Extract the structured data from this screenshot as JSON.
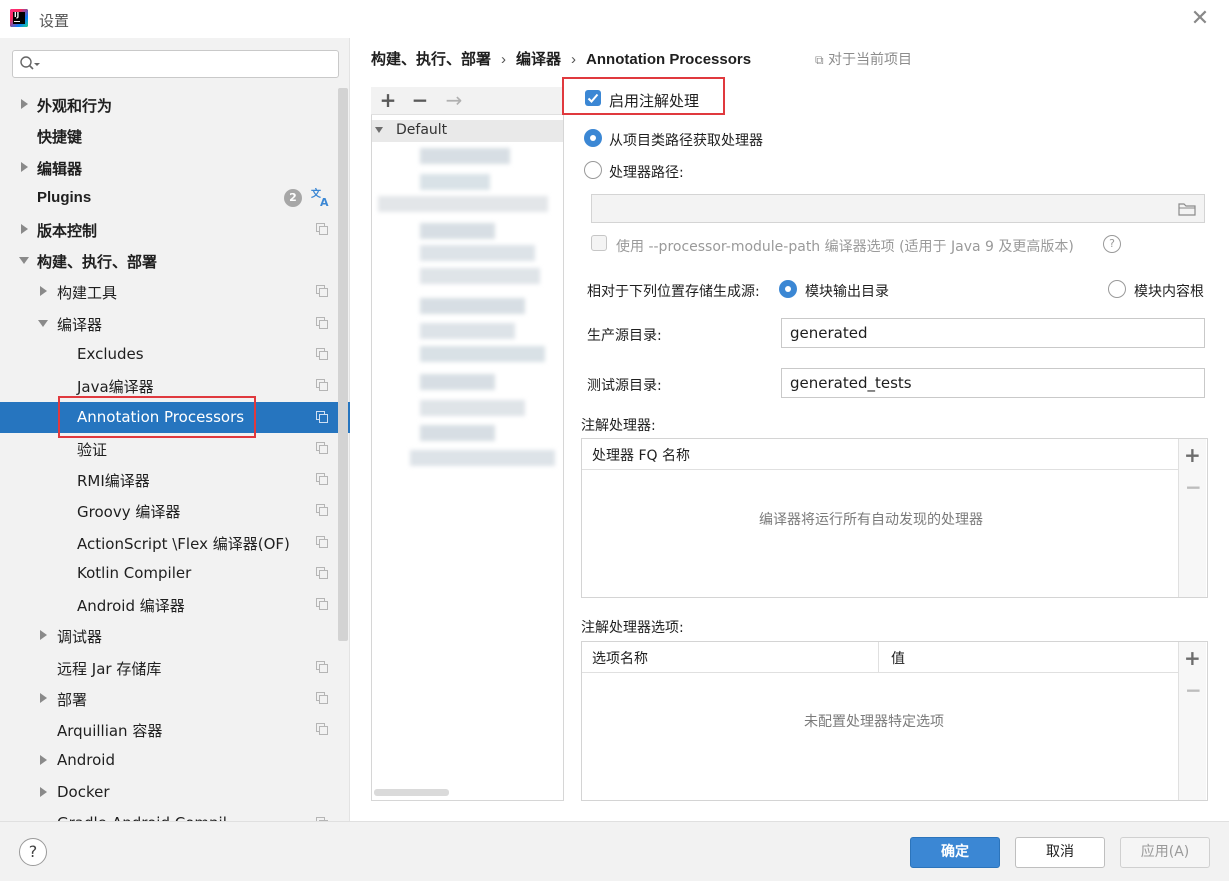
{
  "window": {
    "title": "设置"
  },
  "sidebar": {
    "search_placeholder": "",
    "plugins_badge": "2",
    "items": [
      {
        "label": "外观和行为",
        "arrow": "right",
        "bold": true
      },
      {
        "label": "快捷键",
        "bold": true
      },
      {
        "label": "编辑器",
        "arrow": "right",
        "bold": true
      },
      {
        "label": "Plugins",
        "bold": true
      },
      {
        "label": "版本控制",
        "arrow": "right",
        "bold": true
      },
      {
        "label": "构建、执行、部署",
        "arrow": "down",
        "bold": true
      },
      {
        "label": "构建工具",
        "arrow": "right"
      },
      {
        "label": "编译器",
        "arrow": "down"
      },
      {
        "label": "Excludes"
      },
      {
        "label": "Java编译器"
      },
      {
        "label": "Annotation Processors",
        "selected": true
      },
      {
        "label": "验证"
      },
      {
        "label": "RMI编译器"
      },
      {
        "label": "Groovy 编译器"
      },
      {
        "label": "ActionScript \\Flex 编译器(OF)"
      },
      {
        "label": "Kotlin Compiler"
      },
      {
        "label": "Android 编译器"
      },
      {
        "label": "调试器",
        "arrow": "right"
      },
      {
        "label": "远程 Jar 存储库"
      },
      {
        "label": "部署",
        "arrow": "right"
      },
      {
        "label": "Arquillian 容器"
      },
      {
        "label": "Android",
        "arrow": "right"
      },
      {
        "label": "Docker",
        "arrow": "right"
      },
      {
        "label": "Gradle-Android Compil..."
      }
    ]
  },
  "breadcrumb": {
    "part1": "构建、执行、部署",
    "part2": "编译器",
    "part3": "Annotation Processors",
    "scope": "对于当前项目"
  },
  "profiles": {
    "default_label": "Default"
  },
  "settings": {
    "enable_label": "启用注解处理",
    "from_classpath_label": "从项目类路径获取处理器",
    "processor_path_label": "处理器路径:",
    "processor_path_value": "",
    "module_path_label": "使用 --processor-module-path 编译器选项 (适用于 Java 9 及更高版本)",
    "store_relative_label": "相对于下列位置存储生成源:",
    "module_output_label": "模块输出目录",
    "module_content_label": "模块内容根",
    "prod_dir_label": "生产源目录:",
    "prod_dir_value": "generated",
    "test_dir_label": "测试源目录:",
    "test_dir_value": "generated_tests",
    "processors_label": "注解处理器:",
    "processors_col": "处理器 FQ 名称",
    "processors_empty": "编译器将运行所有自动发现的处理器",
    "options_label": "注解处理器选项:",
    "options_col_name": "选项名称",
    "options_col_value": "值",
    "options_empty": "未配置处理器特定选项"
  },
  "footer": {
    "help": "?",
    "ok": "确定",
    "cancel": "取消",
    "apply": "应用(A)"
  },
  "colors": {
    "accent": "#3b87d4",
    "selection": "#2675bf",
    "highlight_border": "#e0393e"
  }
}
